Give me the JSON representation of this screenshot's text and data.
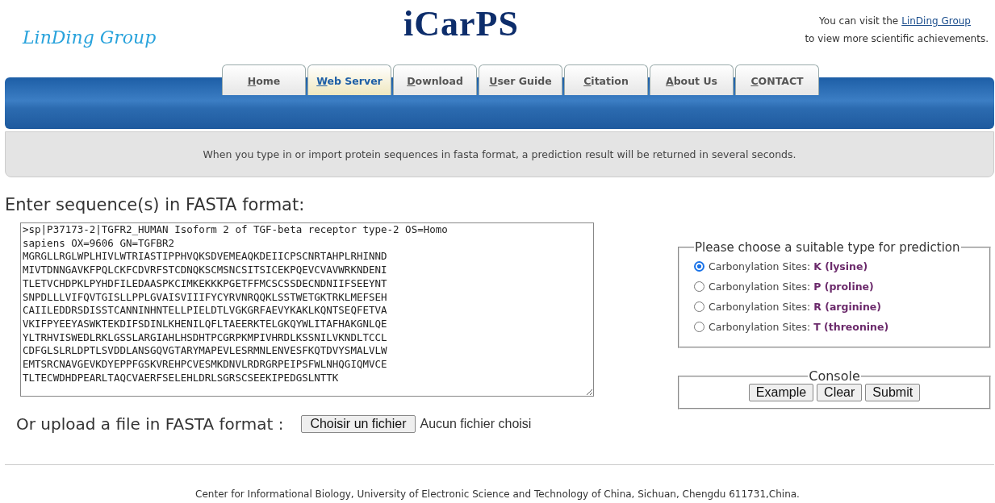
{
  "header": {
    "logo": "LinDing Group",
    "title": "iCarPS",
    "visit_text": "You can visit the",
    "visit_link": "LinDing Group",
    "visit_text_2": "to view more scientific achievements."
  },
  "tabs": [
    {
      "label": "Home",
      "selected": false
    },
    {
      "label": "Web Server",
      "selected": true
    },
    {
      "label": "Download",
      "selected": false
    },
    {
      "label": "User Guide",
      "selected": false
    },
    {
      "label": "Citation",
      "selected": false
    },
    {
      "label": "About Us",
      "selected": false
    },
    {
      "label": "CONTACT",
      "selected": false
    }
  ],
  "notice": "When you type in or import protein sequences in fasta format, a prediction result will be returned in several seconds.",
  "sequence_heading": "Enter sequence(s) in FASTA format:",
  "sequence_lines": [
    ">sp|P37173-2|TGFR2_HUMAN Isoform 2 of TGF-beta receptor type-2 OS=Homo",
    "sapiens OX=9606 GN=TGFBR2",
    "MGRGLLRGLWPLHIVLWTRIASTIPPHVQKSDVEMEAQKDEIICPSCNRTAHPLRHINND",
    "MIVTDNNGAVKFPQLCKFCDVRFSTCDNQKSCMSNCSITSICEKPQEVCVAVWRKNDENI",
    "TLETVCHDPKLPYHDFILEDAASPKCIMKEKKKPGETFFMCSCSSDECNDNIIFSEEYNT",
    "SNPDLLLVIFQVTGISLLPPLGVAISVIIIFYCYRVNRQQKLSSTWETGKTRKLMEFSEH",
    "CAIILEDDRSDISSTCANNINHNTELLPIELDTLVGKGRFAEVYKAKLKQNTSEQFETVA",
    "VKIFPYEEYASWKTEKDIFSDINLKHENILQFLTAEERKTELGKQYWLITAFHAKGNLQE",
    "YLTRHVISWEDLRKLGSSLARGIAHLHSDHTPCGRPKMPIVHRDLKSSNILVKNDLTCCL",
    "CDFGLSLRLDPTLSVDDLANSGQVGTARYMAPEVLESRMNLENVESFKQTDVYSMALVLW",
    "EMTSRCNAVGEVKDYEPPFGSKVREHPCVESMKDNVLRDRGRPEIPSFWLNHQGIQMVCE",
    "TLTECWDHDPEARLTAQCVAERFSELEHLDRLSGRSCSEEKIPEDGSLNTTK"
  ],
  "upload": {
    "label": "Or upload a file in FASTA format :",
    "button": "Choisir un fichier",
    "status": "Aucun fichier choisi"
  },
  "prediction": {
    "legend": "Please choose a suitable type for prediction",
    "options": [
      {
        "prefix": "Carbonylation Sites:",
        "site": "K (lysine)",
        "selected": true
      },
      {
        "prefix": "Carbonylation Sites:",
        "site": "P (proline)",
        "selected": false
      },
      {
        "prefix": "Carbonylation Sites:",
        "site": "R (arginine)",
        "selected": false
      },
      {
        "prefix": "Carbonylation Sites:",
        "site": "T (threonine)",
        "selected": false
      }
    ]
  },
  "console": {
    "legend": "Console",
    "buttons": [
      "Example",
      "Clear",
      "Submit"
    ]
  },
  "footer": "Center for Informational Biology, University of Electronic Science and Technology of China, Sichuan, Chengdu 611731,China."
}
